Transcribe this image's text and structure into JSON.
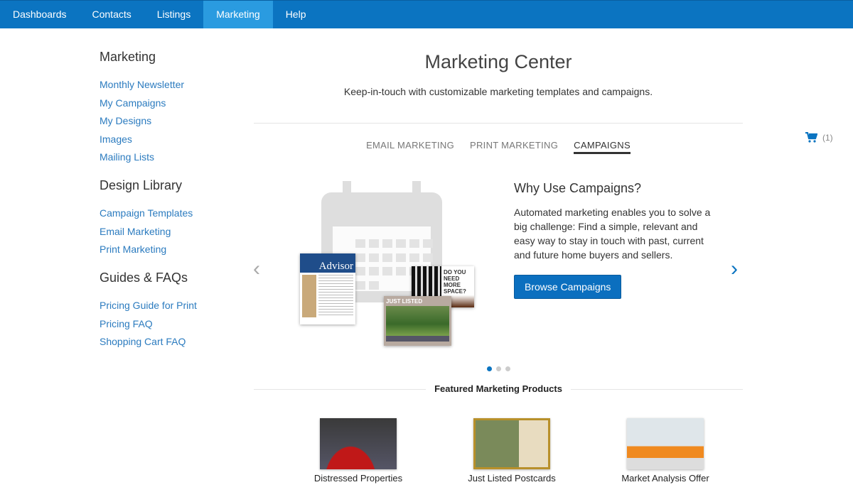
{
  "nav": {
    "items": [
      "Dashboards",
      "Contacts",
      "Listings",
      "Marketing",
      "Help"
    ],
    "active": "Marketing"
  },
  "sidebar": {
    "groups": [
      {
        "title": "Marketing",
        "links": [
          "Monthly Newsletter",
          "My Campaigns",
          "My Designs",
          "Images",
          "Mailing Lists"
        ]
      },
      {
        "title": "Design Library",
        "links": [
          "Campaign Templates",
          "Email Marketing",
          "Print Marketing"
        ]
      },
      {
        "title": "Guides & FAQs",
        "links": [
          "Pricing Guide for Print",
          "Pricing FAQ",
          "Shopping Cart FAQ"
        ]
      }
    ]
  },
  "main": {
    "title": "Marketing Center",
    "subtitle": "Keep-in-touch with customizable marketing templates and campaigns.",
    "tabs": [
      "EMAIL MARKETING",
      "PRINT MARKETING",
      "CAMPAIGNS"
    ],
    "active_tab": "CAMPAIGNS"
  },
  "cart": {
    "icon": "cart-icon",
    "count": "(1)"
  },
  "carousel": {
    "heading": "Why Use Campaigns?",
    "body": "Automated marketing enables you to solve a big challenge: Find a simple, relevant and easy way to stay in touch with past, current and future home buyers and sellers.",
    "button": "Browse Campaigns",
    "slides": 3,
    "active_slide": 1,
    "image_text": {
      "newsletter": "Advisor",
      "postcard": "DO YOU NEED MORE SPACE?",
      "listed": "JUST LISTED"
    }
  },
  "featured": {
    "heading": "Featured Marketing Products",
    "products": [
      "Distressed Properties",
      "Just Listed Postcards",
      "Market Analysis Offer"
    ]
  },
  "colors": {
    "nav": "#0b74c1",
    "nav_active": "#2a9be0",
    "link": "#2b7bbf",
    "button": "#0b6fbf"
  }
}
